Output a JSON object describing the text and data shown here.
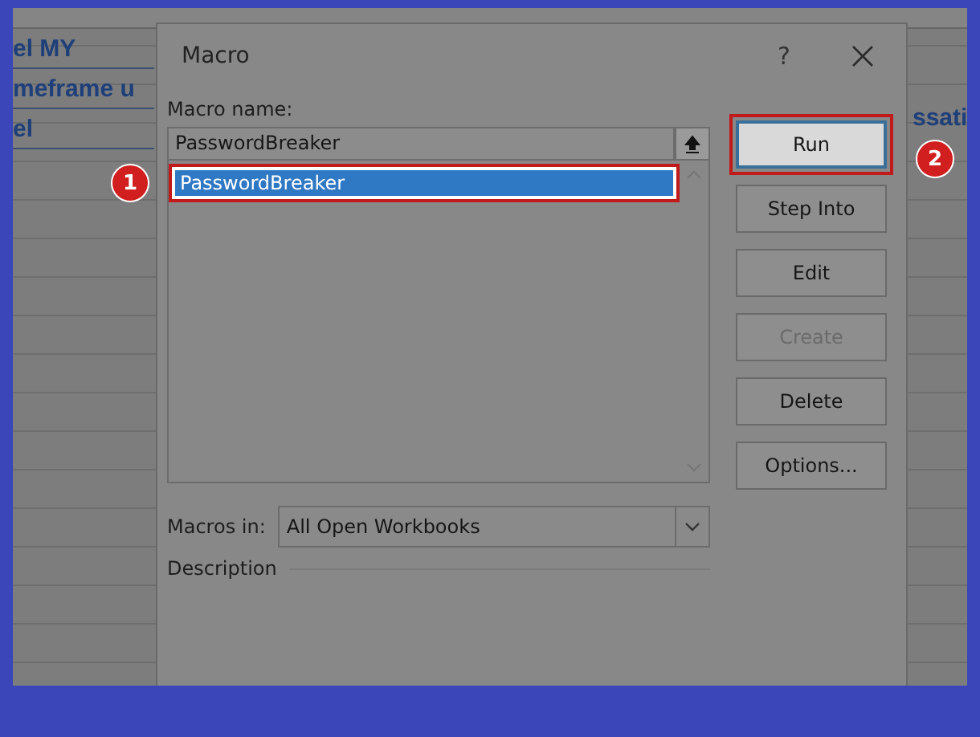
{
  "sheet": {
    "left_cells": [
      "el MY",
      "meframe u",
      "el"
    ],
    "right_cell": "ssati"
  },
  "dialog": {
    "title": "Macro",
    "help": "?",
    "macro_name_label": "Macro name:",
    "macro_name_value": "PasswordBreaker",
    "macros": [
      {
        "name": "PasswordBreaker",
        "selected": true,
        "highlighted": true
      }
    ],
    "buttons": [
      {
        "label": "Run",
        "disabled": false,
        "highlighted": true
      },
      {
        "label": "Step Into",
        "disabled": false,
        "highlighted": false
      },
      {
        "label": "Edit",
        "disabled": false,
        "highlighted": false
      },
      {
        "label": "Create",
        "disabled": true,
        "highlighted": false
      },
      {
        "label": "Delete",
        "disabled": false,
        "highlighted": false
      },
      {
        "label": "Options...",
        "disabled": false,
        "highlighted": false
      }
    ],
    "macros_in_label": "Macros in:",
    "macros_in_value": "All Open Workbooks",
    "description_label": "Description"
  },
  "annotations": [
    {
      "label": "1"
    },
    {
      "label": "2"
    }
  ]
}
